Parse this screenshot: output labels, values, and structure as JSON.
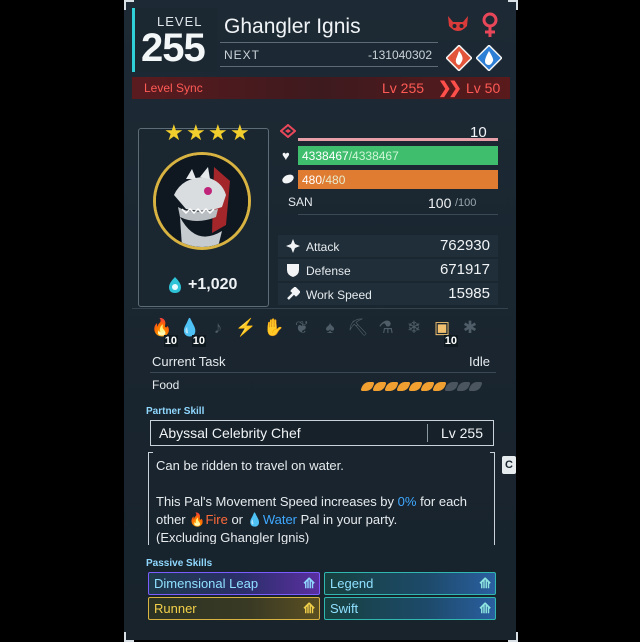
{
  "header": {
    "level_label": "LEVEL",
    "level_value": "255",
    "pal_name": "Ghangler Ignis",
    "next_label": "NEXT",
    "next_value": "-131040302",
    "icons": [
      "dark-demon-icon",
      "female-symbol-icon",
      "fire-element-icon",
      "water-element-icon"
    ]
  },
  "level_sync": {
    "label": "Level Sync",
    "from": "Lv 255",
    "arrow": "❯❯",
    "to": "Lv 50"
  },
  "portrait": {
    "stars": 4,
    "star_glyph": "★",
    "capture_value": "+1,020"
  },
  "stats": {
    "rank_value": "10",
    "hp_current": "4338467",
    "hp_max": "/4338467",
    "stamina_current": "480",
    "stamina_max": "/480",
    "san_label": "SAN",
    "san_current": "100",
    "san_max": "/100",
    "attack_label": "Attack",
    "attack_value": "762930",
    "defense_label": "Defense",
    "defense_value": "671917",
    "work_speed_label": "Work Speed",
    "work_speed_value": "15985"
  },
  "work": {
    "suitabilities": [
      {
        "icon": "kindling-icon",
        "glyph": "🔥",
        "active": true,
        "value": "10"
      },
      {
        "icon": "watering-icon",
        "glyph": "💧",
        "active": true,
        "value": "10"
      },
      {
        "icon": "planting-icon",
        "glyph": "♪",
        "active": false,
        "value": ""
      },
      {
        "icon": "electricity-icon",
        "glyph": "⚡",
        "active": false,
        "value": ""
      },
      {
        "icon": "handiwork-icon",
        "glyph": "✋",
        "active": false,
        "value": ""
      },
      {
        "icon": "gathering-icon",
        "glyph": "❦",
        "active": false,
        "value": ""
      },
      {
        "icon": "lumbering-icon",
        "glyph": "♠",
        "active": false,
        "value": ""
      },
      {
        "icon": "mining-icon",
        "glyph": "⛏",
        "active": false,
        "value": ""
      },
      {
        "icon": "medicine-icon",
        "glyph": "⚗",
        "active": false,
        "value": ""
      },
      {
        "icon": "cooling-icon",
        "glyph": "❄",
        "active": false,
        "value": ""
      },
      {
        "icon": "transporting-icon",
        "glyph": "▣",
        "active": true,
        "value": "10"
      },
      {
        "icon": "farming-icon",
        "glyph": "✱",
        "active": false,
        "value": ""
      }
    ],
    "current_task_label": "Current Task",
    "current_task_value": "Idle",
    "food_label": "Food",
    "food_filled": 7,
    "food_total": 10
  },
  "partner_skill": {
    "section_title": "Partner Skill",
    "name": "Abyssal Celebrity Chef",
    "level": "Lv  255",
    "desc_line1": "Can be ridden to travel on water.",
    "desc_line2_a": "This Pal's Movement Speed increases by ",
    "desc_line2_b": "0%",
    "desc_line2_c": " for each",
    "desc_line3_a": "other ",
    "desc_line3_fire": "Fire",
    "desc_line3_or": " or ",
    "desc_line3_water": "Water",
    "desc_line3_c": " Pal in your party.",
    "desc_line4": "(Excluding Ghangler Ignis)",
    "side_tab": "C"
  },
  "passive_skills": {
    "section_title": "Passive Skills",
    "items": [
      {
        "name": "Dimensional Leap",
        "rank_icon": "rank-up-triple-icon"
      },
      {
        "name": "Legend",
        "rank_icon": "rank-up-triple-icon"
      },
      {
        "name": "Runner",
        "rank_icon": "rank-up-triple-icon"
      },
      {
        "name": "Swift",
        "rank_icon": "rank-up-triple-icon"
      }
    ]
  },
  "colors": {
    "accent_cyan": "#2fd0d8",
    "hp_green": "#3fbf6e",
    "stamina_orange": "#e07b32",
    "sync_red": "#ff5a55",
    "star_gold": "#f2cf2c",
    "food_orange": "#f0a030"
  }
}
